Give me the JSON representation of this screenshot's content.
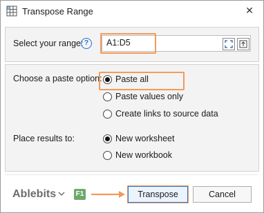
{
  "window": {
    "title": "Transpose Range",
    "close_label": "✕"
  },
  "range": {
    "label": "Select your range:",
    "help": "?",
    "value": "A1:D5"
  },
  "paste": {
    "label": "Choose a paste option:",
    "options": [
      "Paste all",
      "Paste values only",
      "Create links to source data"
    ],
    "selected": 0
  },
  "results": {
    "label": "Place results to:",
    "options": [
      "New worksheet",
      "New workbook"
    ],
    "selected": 0
  },
  "footer": {
    "brand": "Ablebits",
    "f1": "F1",
    "primary_label": "Transpose",
    "secondary_label": "Cancel"
  },
  "colors": {
    "accent": "#2b78d0",
    "highlight": "#f29a5a",
    "f1_badge": "#6ea86a"
  },
  "icons": [
    "table-grid-icon",
    "close-icon",
    "help-icon",
    "select-range-icon",
    "expand-icon",
    "chevron-down-icon",
    "arrow-right-icon"
  ]
}
